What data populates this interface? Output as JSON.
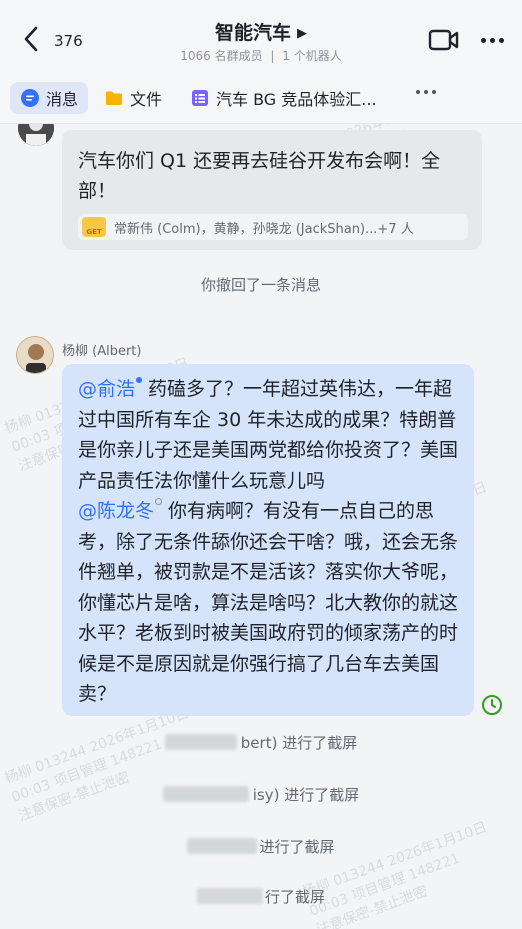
{
  "header": {
    "back_count": "376",
    "title": "智能汽车",
    "member_count": "1066 名群成员",
    "separator": "|",
    "bot_count": "1 个机器人"
  },
  "tabs": [
    {
      "label": "消息",
      "icon": "message-icon",
      "active": true
    },
    {
      "label": "文件",
      "icon": "folder-icon",
      "active": false
    },
    {
      "label": "汽车 BG 竞品体验汇...",
      "icon": "doc-list-icon",
      "active": false
    }
  ],
  "messages": {
    "first": {
      "text": "汽车你们 Q1 还要再去硅谷开发布会啊！全部！",
      "readers": "常新伟 (Colm)，黄静，孙晓龙 (JackShan)...+7 人",
      "reader_badge": "GET"
    },
    "recall_note": "你撤回了一条消息",
    "second": {
      "sender": "杨柳 (Albert)",
      "mention1": "@俞浩",
      "text1": "药磕多了？一年超过英伟达，一年超过中国所有车企 30 年未达成的成果？特朗普是你亲儿子还是美国两党都给你投资了？美国产品责任法你懂什么玩意儿吗",
      "mention2": "@陈龙冬",
      "text2": "你有病啊？有没有一点自己的思考，除了无条件舔你还会干啥？哦，还会无条件翘单，被罚款是不是活该？落实你大爷呢，你懂芯片是啥，算法是啥吗？北大教你的就这水平？老板到时被美国政府罚的倾家荡产的时候是不是原因就是你强行搞了几台车去美国卖？"
    },
    "system_notes": [
      "bert) 进行了截屏",
      "isy) 进行了截屏",
      "进行了截屏",
      "行了截屏"
    ]
  },
  "watermark": {
    "line1": "杨柳 013244 2026年1月10日",
    "line2": "00:03 项目管理 148221",
    "line3": "注意保密-禁止泄密"
  },
  "colors": {
    "accent": "#3370ff",
    "bubble_own": "#d5e4fb",
    "bubble_other": "#e7e8eb",
    "read_ok": "#2ea121"
  }
}
